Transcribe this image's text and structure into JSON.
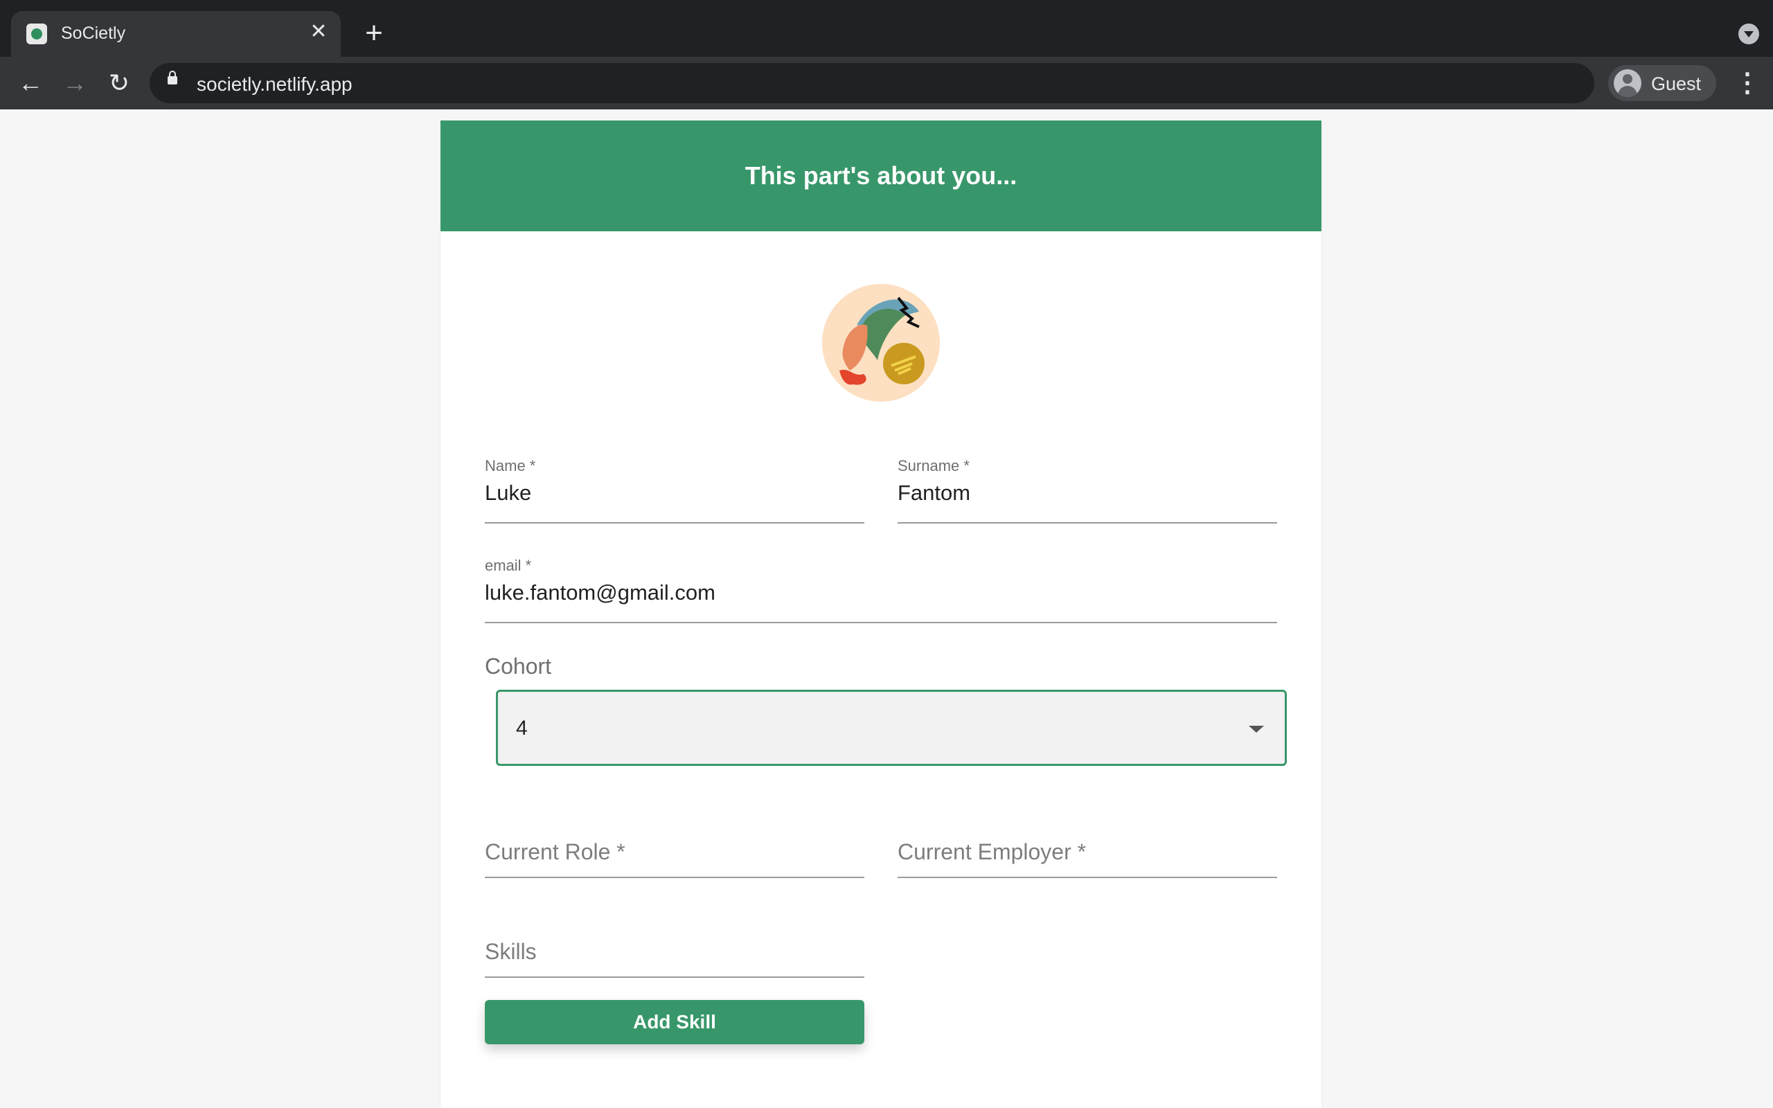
{
  "browser": {
    "tab_title": "SoCietly",
    "url": "societly.netlify.app",
    "profile_label": "Guest"
  },
  "page": {
    "header_title": "This part's about you...",
    "form": {
      "name": {
        "label": "Name *",
        "value": "Luke"
      },
      "surname": {
        "label": "Surname *",
        "value": "Fantom"
      },
      "email": {
        "label": "email *",
        "value": "luke.fantom@gmail.com"
      },
      "cohort": {
        "label": "Cohort",
        "selected": "4"
      },
      "current_role": {
        "placeholder": "Current Role *"
      },
      "current_employer": {
        "placeholder": "Current Employer *"
      },
      "skills": {
        "placeholder": "Skills"
      },
      "add_skill_label": "Add Skill"
    }
  },
  "colors": {
    "brand_green": "#38976a"
  }
}
